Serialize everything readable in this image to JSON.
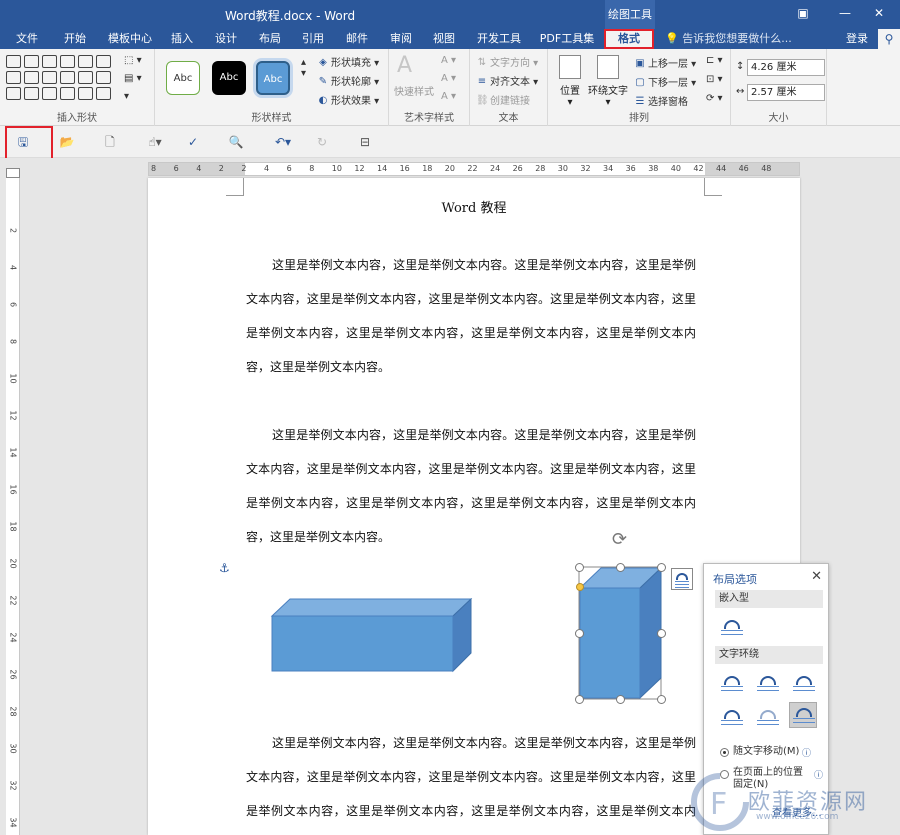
{
  "window": {
    "title": "Word教程.docx - Word",
    "context_tab": "绘图工具",
    "min_icon": "—",
    "close_icon": "✕",
    "restore_icon": "▣"
  },
  "tabs": [
    {
      "label": "文件"
    },
    {
      "label": "开始"
    },
    {
      "label": "模板中心"
    },
    {
      "label": "插入"
    },
    {
      "label": "设计"
    },
    {
      "label": "布局"
    },
    {
      "label": "引用"
    },
    {
      "label": "邮件"
    },
    {
      "label": "审阅"
    },
    {
      "label": "视图"
    },
    {
      "label": "开发工具"
    },
    {
      "label": "PDF工具集"
    },
    {
      "label": "格式"
    }
  ],
  "tell_me": "告诉我您想要做什么...",
  "login": "登录",
  "ribbon": {
    "insert_shapes_label": "插入形状",
    "shape_styles_label": "形状样式",
    "style_preview_text": "Abc",
    "shape_fill": "形状填充",
    "shape_outline": "形状轮廓",
    "shape_effects": "形状效果",
    "wordart_label": "艺术字样式",
    "quick_styles": "快速样式",
    "text_label": "文本",
    "text_direction": "文字方向",
    "align_text": "对齐文本",
    "create_link": "创建链接",
    "arrange_label": "排列",
    "position": "位置",
    "wrap_text": "环绕文字",
    "bring_forward": "上移一层",
    "send_backward": "下移一层",
    "selection_pane": "选择窗格",
    "size_label": "大小",
    "height_value": "4.26 厘米",
    "width_value": "2.57 厘米"
  },
  "ruler_h": [
    "8",
    "6",
    "4",
    "2",
    "2",
    "4",
    "6",
    "8",
    "10",
    "12",
    "14",
    "16",
    "18",
    "20",
    "22",
    "24",
    "26",
    "28",
    "30",
    "32",
    "34",
    "36",
    "38",
    "40",
    "42",
    "44",
    "46",
    "48"
  ],
  "ruler_v": [
    "2",
    "4",
    "6",
    "8",
    "10",
    "12",
    "14",
    "16",
    "18",
    "20",
    "22",
    "24",
    "26",
    "28",
    "30",
    "32",
    "34"
  ],
  "document": {
    "title": "Word 教程",
    "paragraphs": [
      "这里是举例文本内容，这里是举例文本内容。这里是举例文本内容，这里是举例文本内容，这里是举例文本内容，这里是举例文本内容。这里是举例文本内容，这里是举例文本内容，这里是举例文本内容，这里是举例文本内容，这里是举例文本内容，这里是举例文本内容。",
      "这里是举例文本内容，这里是举例文本内容。这里是举例文本内容，这里是举例文本内容，这里是举例文本内容，这里是举例文本内容。这里是举例文本内容，这里是举例文本内容，这里是举例文本内容，这里是举例文本内容，这里是举例文本内容，这里是举例文本内容。",
      "这里是举例文本内容，这里是举例文本内容。这里是举例文本内容，这里是举例文本内容，这里是举例文本内容，这里是举例文本内容。这里是举例文本内容，这里是举例文本内容，这里是举例文本内容，这里是举例文本内容，这里是举例文本内容，这里是举例文本内容。"
    ]
  },
  "layout_options": {
    "title": "布局选项",
    "inline_section": "嵌入型",
    "wrap_section": "文字环绕",
    "move_with_text": "随文字移动(M)",
    "fix_on_page": "在页面上的位置固定(N)",
    "see_more": "查看更多..."
  },
  "watermark": {
    "text": "欧菲资源网",
    "url": "www.office26.com"
  },
  "colors": {
    "ribbon_blue": "#2b579a",
    "shape_fill": "#5b9bd5",
    "highlight_red": "#e2212b"
  }
}
